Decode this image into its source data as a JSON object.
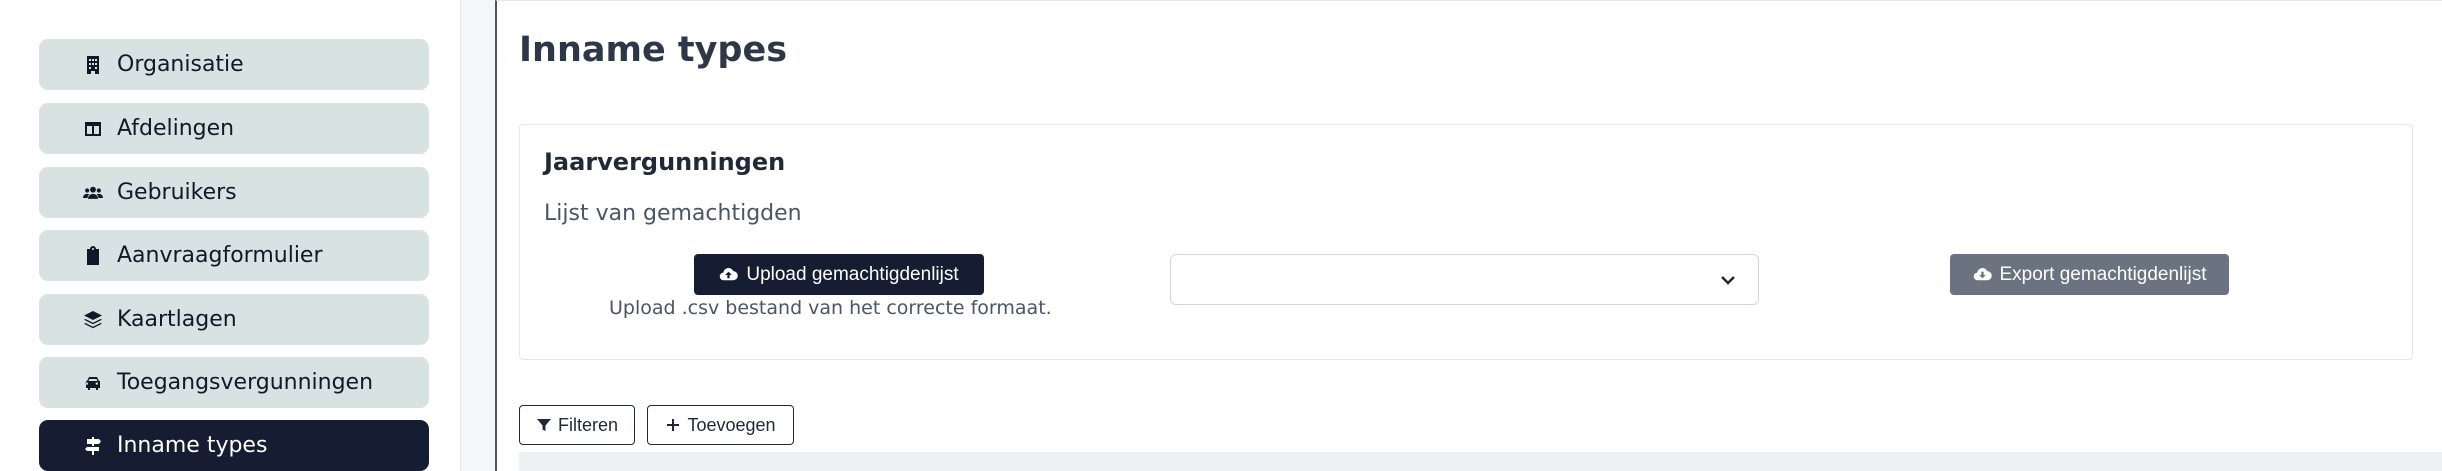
{
  "sidebar": {
    "items": [
      {
        "label": "Organisatie",
        "icon": "building-icon"
      },
      {
        "label": "Afdelingen",
        "icon": "table-columns-icon"
      },
      {
        "label": "Gebruikers",
        "icon": "users-icon"
      },
      {
        "label": "Aanvraagformulier",
        "icon": "clipboard-icon"
      },
      {
        "label": "Kaartlagen",
        "icon": "layers-icon"
      },
      {
        "label": "Toegangsvergunningen",
        "icon": "car-icon"
      },
      {
        "label": "Inname types",
        "icon": "signs-post-icon"
      }
    ],
    "active_index": 6
  },
  "main": {
    "title": "Inname types",
    "card": {
      "title": "Jaarvergunningen",
      "subtitle": "Lijst van gemachtigden",
      "upload_label": "Upload gemachtigdenlijst",
      "upload_help": "Upload .csv bestand van het correcte formaat.",
      "select_value": "",
      "export_label": "Export gemachtigdenlijst"
    },
    "toolbar": {
      "filter_label": "Filteren",
      "add_label": "Toevoegen"
    }
  },
  "colors": {
    "active_bg": "#161d33",
    "item_bg": "#d8e2e2",
    "export_bg": "#6b7280"
  }
}
